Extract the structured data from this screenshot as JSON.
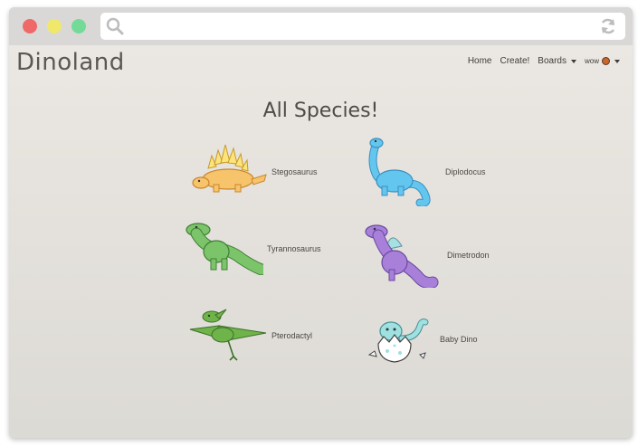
{
  "window": {
    "title_bar_colors": {
      "close": "#ef6969",
      "minimize": "#efe86b",
      "maximize": "#73da98"
    },
    "search_icon": "search-icon",
    "reload_icon": "reload-icon"
  },
  "header": {
    "brand": "Dinoland",
    "nav": {
      "home": "Home",
      "create": "Create!",
      "boards": "Boards",
      "user": "wow"
    }
  },
  "main": {
    "title": "All Species!",
    "species": [
      {
        "name": "Stegosaurus",
        "color": "#f7c46b",
        "icon": "stegosaurus-icon"
      },
      {
        "name": "Diplodocus",
        "color": "#63c6ef",
        "icon": "diplodocus-icon"
      },
      {
        "name": "Tyrannosaurus",
        "color": "#7cc46a",
        "icon": "tyrannosaurus-icon"
      },
      {
        "name": "Dimetrodon",
        "color": "#a87fd9",
        "icon": "dimetrodon-icon"
      },
      {
        "name": "Pterodactyl",
        "color": "#6fb44a",
        "icon": "pterodactyl-icon"
      },
      {
        "name": "Baby Dino",
        "color": "#9fe0e0",
        "icon": "baby-dino-icon"
      }
    ]
  }
}
